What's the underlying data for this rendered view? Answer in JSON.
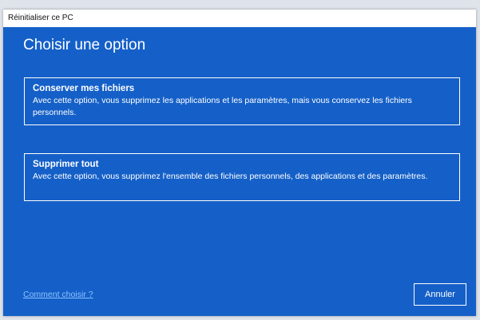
{
  "window": {
    "title": "Réinitialiser ce PC"
  },
  "main": {
    "heading": "Choisir une option",
    "options": [
      {
        "title": "Conserver mes fichiers",
        "description": "Avec cette option, vous supprimez les applications et les paramètres, mais vous conservez les fichiers personnels."
      },
      {
        "title": "Supprimer tout",
        "description": "Avec cette option, vous supprimez l'ensemble des fichiers personnels, des applications et des paramètres."
      }
    ]
  },
  "footer": {
    "help_link": "Comment choisir ?",
    "cancel_label": "Annuler"
  },
  "colors": {
    "accent_background": "#1560c8",
    "link": "#8cc2ff",
    "text": "#ffffff"
  }
}
